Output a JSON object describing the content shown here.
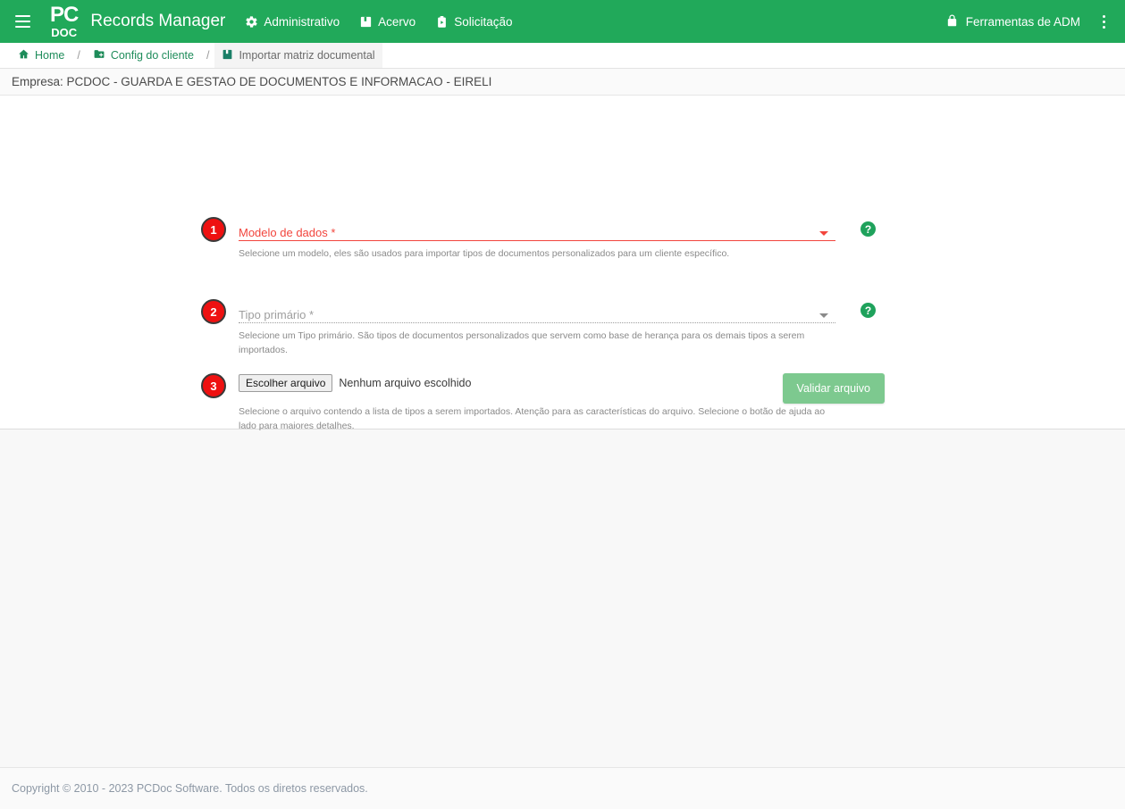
{
  "topbar": {
    "menu_icon": "hamburger-icon",
    "logo_line1": "PC",
    "logo_line2": "DOC",
    "app_name": "Records Manager",
    "nav": [
      {
        "label": "Administrativo",
        "icon": "gear-icon"
      },
      {
        "label": "Acervo",
        "icon": "book-icon"
      },
      {
        "label": "Solicitação",
        "icon": "clipboard-icon"
      }
    ],
    "adm_tools": {
      "label": "Ferramentas de ADM",
      "icon": "lock-icon"
    },
    "overflow_icon": "kebab-menu-icon",
    "bg_color": "#21A95A"
  },
  "breadcrumb": {
    "items": [
      {
        "label": "Home",
        "icon": "home-icon",
        "active": false
      },
      {
        "label": "Config do cliente",
        "icon": "folder-add-icon",
        "active": false
      },
      {
        "label": "Importar matriz documental",
        "icon": "book-icon",
        "active": true
      }
    ],
    "separator": "/"
  },
  "company_bar": {
    "text": "Empresa: PCDOC - GUARDA E GESTAO DE DOCUMENTOS E INFORMACAO - EIRELI"
  },
  "form": {
    "fields": [
      {
        "step": "1",
        "label": "Modelo de dados *",
        "value": "",
        "hint": "Selecione um modelo, eles são usados para importar tipos de documentos personalizados para um cliente específico.",
        "state": "error",
        "help_icon": "question-mark-icon"
      },
      {
        "step": "2",
        "label": "Tipo primário *",
        "value": "",
        "hint": "Selecione um Tipo primário. São tipos de documentos personalizados que servem como base de herança para os demais tipos a serem importados.",
        "state": "disabled",
        "help_icon": "question-mark-icon"
      },
      {
        "step": "3",
        "file_button_label": "Escolher arquivo",
        "file_status": "Nenhum arquivo escolhido",
        "hint": "Selecione o arquivo contendo a lista de tipos a serem importados. Atenção para as características do arquivo. Selecione o botão de ajuda ao lado para maiores detalhes.",
        "state": "file",
        "help_icon": "question-mark-icon"
      }
    ],
    "submit_label": "Validar arquivo",
    "submit_color": "#7DC98F",
    "error_color": "#f2453d",
    "badge_color": "#ee1111"
  },
  "footer": {
    "text": "Copyright © 2010 - 2023 PCDoc Software. Todos os diretos reservados."
  }
}
